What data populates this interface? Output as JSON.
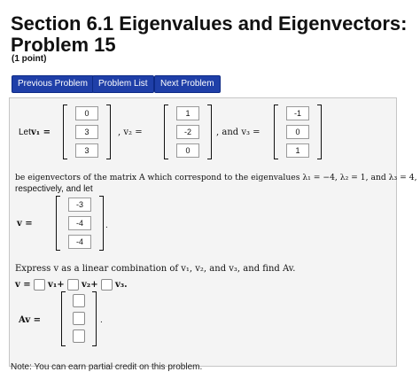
{
  "section_title": "Section 6.1 Eigenvalues and Eigenvectors:",
  "problem_title": "Problem 15",
  "points": "(1 point)",
  "buttons": {
    "previous": "Previous Problem",
    "list": "Problem List",
    "next": "Next Problem"
  },
  "colors": {
    "button": "#1f3fa8",
    "panel": "#f4f4f4",
    "border": "#c6c6c6"
  },
  "problem": {
    "let_text": "Let",
    "v1_label": "v₁ =",
    "v2_label": ", v₂ =",
    "v3_label": ", and v₃ =",
    "v1": [
      "0",
      "3",
      "3"
    ],
    "v2": [
      "1",
      "-2",
      "0"
    ],
    "v3": [
      "-1",
      "0",
      "1"
    ],
    "statement_line1": "be eigenvectors of the matrix A which correspond to the eigenvalues λ₁ = −4, λ₂ = 1, and λ₃ = 4,",
    "statement_line2": "respectively, and let",
    "v_label": "v =",
    "v": [
      "-3",
      "-4",
      "-4"
    ],
    "period": ".",
    "express": "Express v as a linear combination of v₁, v₂, and v₃, and find Av.",
    "comb_v": "v =",
    "comb_v1": "v₁+",
    "comb_v2": "v₂+",
    "comb_v3": "v₃.",
    "av_label": "Av =",
    "av_period": "."
  },
  "note": "Note: You can earn partial credit on this problem."
}
